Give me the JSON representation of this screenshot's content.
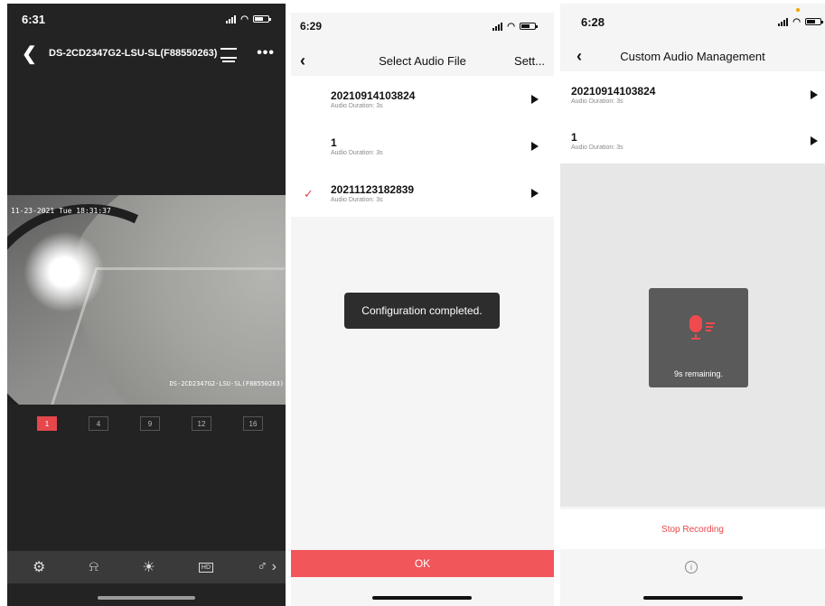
{
  "panel1": {
    "status_time": "6:31",
    "title": "DS-2CD2347G2-LSU-SL(F88550263)",
    "timestamp_overlay": "11-23-2021 Tue 18:31:37",
    "camera_overlay": "DS-2CD2347G2-LSU-SL(F88550263)",
    "grid_options": [
      "1",
      "4",
      "9",
      "12",
      "16"
    ],
    "grid_active": "1",
    "hd_label": "HD",
    "tool_icons": [
      "light-off-icon",
      "bell-icon",
      "light-icon",
      "hd-icon",
      "microphone-icon"
    ]
  },
  "panel2": {
    "status_time": "6:29",
    "title": "Select Audio File",
    "settings_label": "Sett...",
    "files": [
      {
        "name": "20210914103824",
        "duration": "Audio Duration: 3s",
        "selected": false
      },
      {
        "name": "1",
        "duration": "Audio Duration: 3s",
        "selected": false
      },
      {
        "name": "20211123182839",
        "duration": "Audio Duration: 3s",
        "selected": true
      }
    ],
    "toast": "Configuration completed.",
    "ok_label": "OK"
  },
  "panel3": {
    "status_time": "6:28",
    "title": "Custom Audio Management",
    "files": [
      {
        "name": "20210914103824",
        "duration": "Audio Duration: 3s"
      },
      {
        "name": "1",
        "duration": "Audio Duration: 3s"
      }
    ],
    "recording_remaining": "9s remaining.",
    "stop_label": "Stop Recording",
    "info_glyph": "i"
  },
  "colors": {
    "accent_red": "#e5474b",
    "ok_red": "#f1565a",
    "dark_bg": "#232323"
  }
}
